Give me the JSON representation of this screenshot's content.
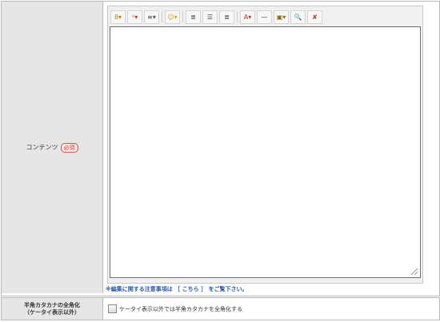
{
  "content_row": {
    "label": "コンテンツ",
    "required_badge": "必須",
    "toolbar": {
      "buttons": [
        {
          "name": "font-size-icon",
          "glyph": "8▾"
        },
        {
          "name": "font-name-icon",
          "glyph": "ᴬ▾"
        },
        {
          "name": "paragraph-icon",
          "glyph": "≡▾"
        },
        {
          "name": "emoticon-icon",
          "glyph": "☺▾"
        },
        {
          "name": "align-left-icon",
          "glyph": "≣"
        },
        {
          "name": "align-center-icon",
          "glyph": "☰"
        },
        {
          "name": "align-right-icon",
          "glyph": "≣"
        },
        {
          "name": "text-color-icon",
          "glyph": "A▾"
        },
        {
          "name": "horizontal-rule-icon",
          "glyph": "—"
        },
        {
          "name": "image-icon",
          "glyph": "▣▾"
        },
        {
          "name": "search-icon",
          "glyph": "🔍"
        },
        {
          "name": "remove-format-icon",
          "glyph": "✘"
        }
      ]
    },
    "note": {
      "prefix": "※編集に関する注意事項は",
      "link_text": "［ こちら ］",
      "suffix": "をご覧下さい。"
    }
  },
  "kana_row": {
    "label_line1": "半角カタカナの全角化",
    "label_line2": "（ケータイ表示以外）",
    "checkbox_label": "ケータイ表示以外では半角カタカナを全角化する",
    "checked": false
  },
  "colors": {
    "label_bg": "#e6e6e6",
    "border": "#b9b9b9",
    "note_blue": "#2b5aa6",
    "required_red": "#d92b2b"
  }
}
